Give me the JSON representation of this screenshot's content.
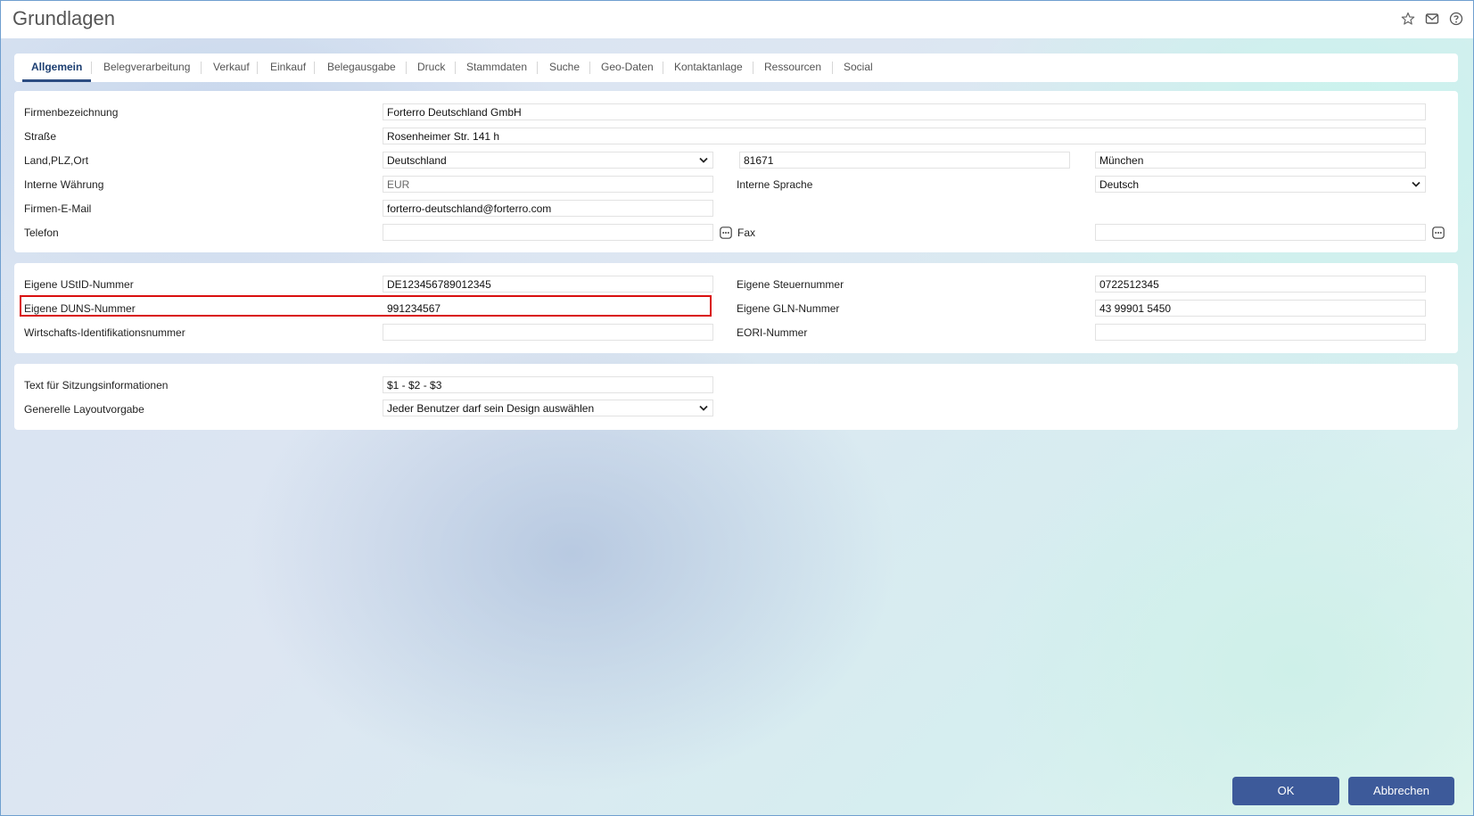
{
  "window": {
    "title": "Grundlagen",
    "icons": [
      "star-icon",
      "mail-icon",
      "help-icon"
    ]
  },
  "tabs": [
    {
      "label": "Allgemein",
      "active": true
    },
    {
      "label": "Belegverarbeitung"
    },
    {
      "label": "Verkauf"
    },
    {
      "label": "Einkauf"
    },
    {
      "label": "Belegausgabe"
    },
    {
      "label": "Druck"
    },
    {
      "label": "Stammdaten"
    },
    {
      "label": "Suche"
    },
    {
      "label": "Geo-Daten"
    },
    {
      "label": "Kontaktanlage"
    },
    {
      "label": "Ressourcen"
    },
    {
      "label": "Social"
    }
  ],
  "company": {
    "name_label": "Firmenbezeichnung",
    "name_value": "Forterro Deutschland GmbH",
    "street_label": "Straße",
    "street_value": "Rosenheimer Str. 141 h",
    "location_label": "Land,PLZ,Ort",
    "country_value": "Deutschland",
    "zip_value": "81671",
    "city_value": "München",
    "currency_label": "Interne Währung",
    "currency_value": "EUR",
    "language_label": "Interne Sprache",
    "language_value": "Deutsch",
    "email_label": "Firmen-E-Mail",
    "email_value": "forterro-deutschland@forterro.com",
    "phone_label": "Telefon",
    "phone_value": "",
    "fax_label": "Fax",
    "fax_value": ""
  },
  "ids": {
    "ustid_label": "Eigene UStID-Nummer",
    "ustid_value": "DE123456789012345",
    "tax_label": "Eigene Steuernummer",
    "tax_value": "0722512345",
    "duns_label": "Eigene DUNS-Nummer",
    "duns_value": "991234567",
    "gln_label": "Eigene GLN-Nummer",
    "gln_value": "43 99901 5450",
    "wid_label": "Wirtschafts-Identifikationsnummer",
    "wid_value": "",
    "eori_label": "EORI-Nummer",
    "eori_value": ""
  },
  "session": {
    "text_label": "Text für Sitzungsinformationen",
    "text_value": "$1 - $2 - $3",
    "layout_label": "Generelle Layoutvorgabe",
    "layout_value": "Jeder Benutzer darf sein Design auswählen"
  },
  "footer": {
    "ok_label": "OK",
    "cancel_label": "Abbrechen"
  },
  "colors": {
    "accent": "#3d5a9a",
    "active_tab": "#1d3f72",
    "highlight_border": "#d90f0f"
  }
}
